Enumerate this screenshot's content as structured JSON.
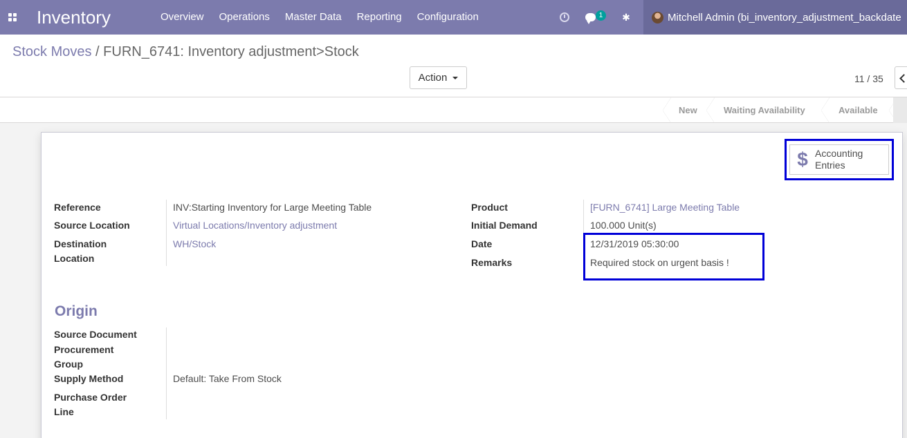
{
  "navbar": {
    "app_title": "Inventory",
    "menu": [
      "Overview",
      "Operations",
      "Master Data",
      "Reporting",
      "Configuration"
    ],
    "messages_badge": "1",
    "user": "Mitchell Admin (bi_inventory_adjustment_backdate"
  },
  "breadcrumb": {
    "parent": "Stock Moves",
    "separator": "/",
    "current": "FURN_6741: Inventory adjustment>Stock"
  },
  "toolbar": {
    "action_label": "Action"
  },
  "pager": {
    "value": "11 / 35"
  },
  "statusbar": {
    "stages": [
      "New",
      "Waiting Availability",
      "Available"
    ]
  },
  "smart_button": {
    "line1": "Accounting",
    "line2": "Entries"
  },
  "form": {
    "left": {
      "reference_label": "Reference",
      "reference_value": "INV:Starting Inventory for Large Meeting Table",
      "source_location_label": "Source Location",
      "source_location_value": "Virtual Locations/Inventory adjustment",
      "destination_label_1": "Destination",
      "destination_label_2": "Location",
      "destination_value": "WH/Stock"
    },
    "right": {
      "product_label": "Product",
      "product_value": "[FURN_6741] Large Meeting Table",
      "initial_demand_label": "Initial Demand",
      "initial_demand_value": "100.000 Unit(s)",
      "date_label": "Date",
      "date_value": "12/31/2019 05:30:00",
      "remarks_label": "Remarks",
      "remarks_value": "Required stock on urgent basis !"
    },
    "origin": {
      "title": "Origin",
      "source_document_label": "Source Document",
      "procurement_label_1": "Procurement",
      "procurement_label_2": "Group",
      "supply_method_label": "Supply Method",
      "supply_method_value": "Default: Take From Stock",
      "pol_label_1": "Purchase Order",
      "pol_label_2": "Line"
    }
  },
  "colors": {
    "brand": "#7c7bad",
    "highlight": "#0000d8",
    "badge": "#00a09d"
  }
}
